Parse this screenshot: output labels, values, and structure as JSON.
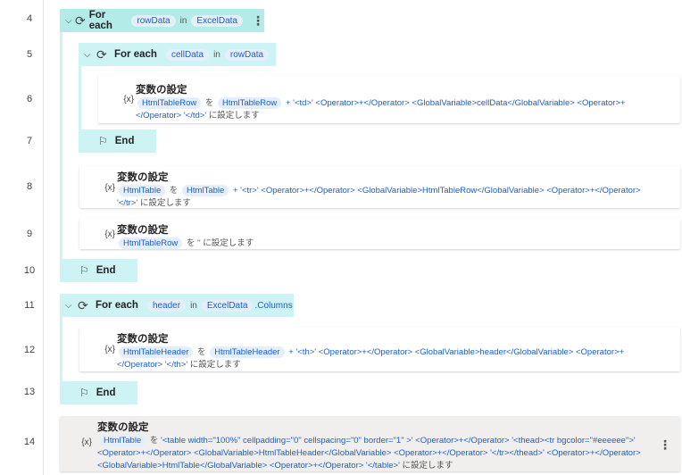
{
  "line_numbers": [
    "4",
    "5",
    "6",
    "7",
    "8",
    "9",
    "10",
    "11",
    "12",
    "13",
    "14"
  ],
  "labels": {
    "for_each": "For each",
    "in": "in",
    "end": "End",
    "set_variable": "変数の設定"
  },
  "loops": [
    {
      "item": "rowData",
      "collection": "ExcelData",
      "suffix": ""
    },
    {
      "item": "cellData",
      "collection": "rowData",
      "suffix": ""
    },
    {
      "item": "header",
      "collection": "ExcelData",
      "suffix": ".Columns"
    }
  ],
  "actions": [
    {
      "segments": [
        {
          "k": "var",
          "t": "HtmlTableRow"
        },
        {
          "k": "txt",
          "t": "を"
        },
        {
          "k": "var",
          "t": "HtmlTableRow"
        },
        {
          "k": "expr",
          "t": "+ '<td>' <Operator>+</Operator> <GlobalVariable>cellData</GlobalVariable> <Operator>+</Operator> '</td>'"
        },
        {
          "k": "txt",
          "t": "に設定します"
        }
      ]
    },
    {
      "segments": [
        {
          "k": "var",
          "t": "HtmlTable"
        },
        {
          "k": "txt",
          "t": "を"
        },
        {
          "k": "var",
          "t": "HtmlTable"
        },
        {
          "k": "expr",
          "t": "+ '<tr>' <Operator>+</Operator> <GlobalVariable>HtmlTableRow</GlobalVariable> <Operator>+</Operator> '</tr>'"
        },
        {
          "k": "txt",
          "t": "に設定します"
        }
      ]
    },
    {
      "segments": [
        {
          "k": "var",
          "t": "HtmlTableRow"
        },
        {
          "k": "txt",
          "t": "を '' に設定します"
        }
      ]
    },
    {
      "segments": [
        {
          "k": "var",
          "t": "HtmlTableHeader"
        },
        {
          "k": "txt",
          "t": "を"
        },
        {
          "k": "var",
          "t": "HtmlTableHeader"
        },
        {
          "k": "expr",
          "t": "+ '<th>' <Operator>+</Operator> <GlobalVariable>header</GlobalVariable> <Operator>+</Operator> '</th>'"
        },
        {
          "k": "txt",
          "t": "に設定します"
        }
      ]
    },
    {
      "segments": [
        {
          "k": "var",
          "t": "HtmlTable"
        },
        {
          "k": "txt",
          "t": "を"
        },
        {
          "k": "expr",
          "t": "'<table width=\"100%\" cellpadding=\"0\" cellspacing=\"0\" border=\"1\" >' <Operator>+</Operator> '<thead><tr bgcolor=\"#eeeeee\">' <Operator>+</Operator> <GlobalVariable>HtmlTableHeader</GlobalVariable> <Operator>+</Operator> '</tr></thead>' <Operator>+</Operator> <GlobalVariable>HtmlTable</GlobalVariable> <Operator>+</Operator> '</table>'"
        },
        {
          "k": "txt",
          "t": "に設定します"
        }
      ]
    }
  ],
  "icons": {
    "loop": "loop-icon",
    "end": "flag-icon",
    "variable": "variable-icon",
    "expand": "chevron-down-icon",
    "more": "more-icon"
  },
  "colors": {
    "loop_header": "#cdf3f5",
    "loop_header_selected": "#b2ebe8",
    "variable": "#1b5fc7",
    "selected_action": "#f0efee"
  }
}
